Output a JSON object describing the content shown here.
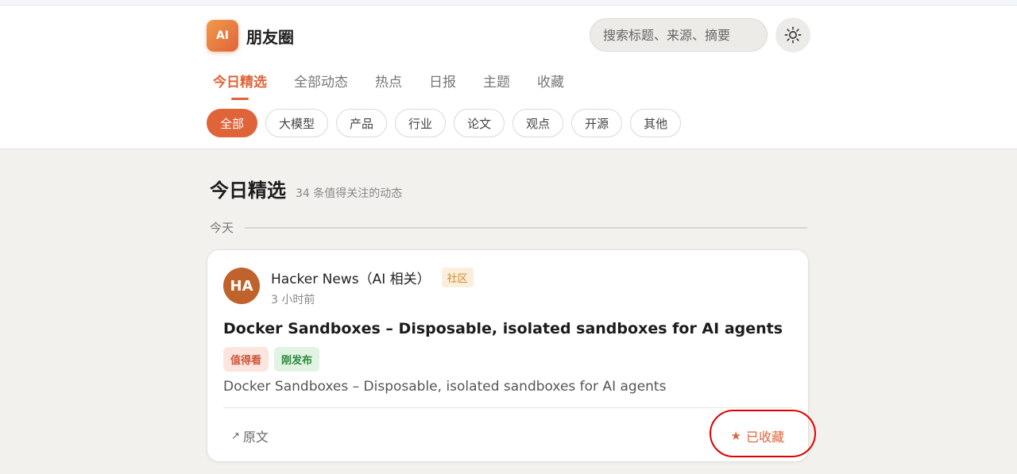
{
  "brand": {
    "logo_text": "AI",
    "name": "朋友圈",
    "accent_color": "#e0643a"
  },
  "search": {
    "placeholder": "搜索标题、来源、摘要"
  },
  "theme_toggle": {
    "icon": "sun-icon"
  },
  "tabs": [
    {
      "label": "今日精选",
      "active": true
    },
    {
      "label": "全部动态"
    },
    {
      "label": "热点"
    },
    {
      "label": "日报"
    },
    {
      "label": "主题"
    },
    {
      "label": "收藏"
    }
  ],
  "filters": [
    {
      "label": "全部",
      "active": true
    },
    {
      "label": "大模型"
    },
    {
      "label": "产品"
    },
    {
      "label": "行业"
    },
    {
      "label": "论文"
    },
    {
      "label": "观点"
    },
    {
      "label": "开源"
    },
    {
      "label": "其他"
    }
  ],
  "section": {
    "title": "今日精选",
    "subtitle": "34 条值得关注的动态"
  },
  "day_label": "今天",
  "card": {
    "avatar": "HA",
    "source": "Hacker News（AI 相关）",
    "source_tag": "社区",
    "time": "3 小时前",
    "title": "Docker Sandboxes – Disposable, isolated sandboxes for AI agents",
    "badges": {
      "worth": "值得看",
      "fresh": "刚发布"
    },
    "summary": "Docker Sandboxes – Disposable, isolated sandboxes for AI agents",
    "link_arrow": "↗",
    "link_label": "原文",
    "fav_star": "★",
    "fav_label": "已收藏"
  }
}
